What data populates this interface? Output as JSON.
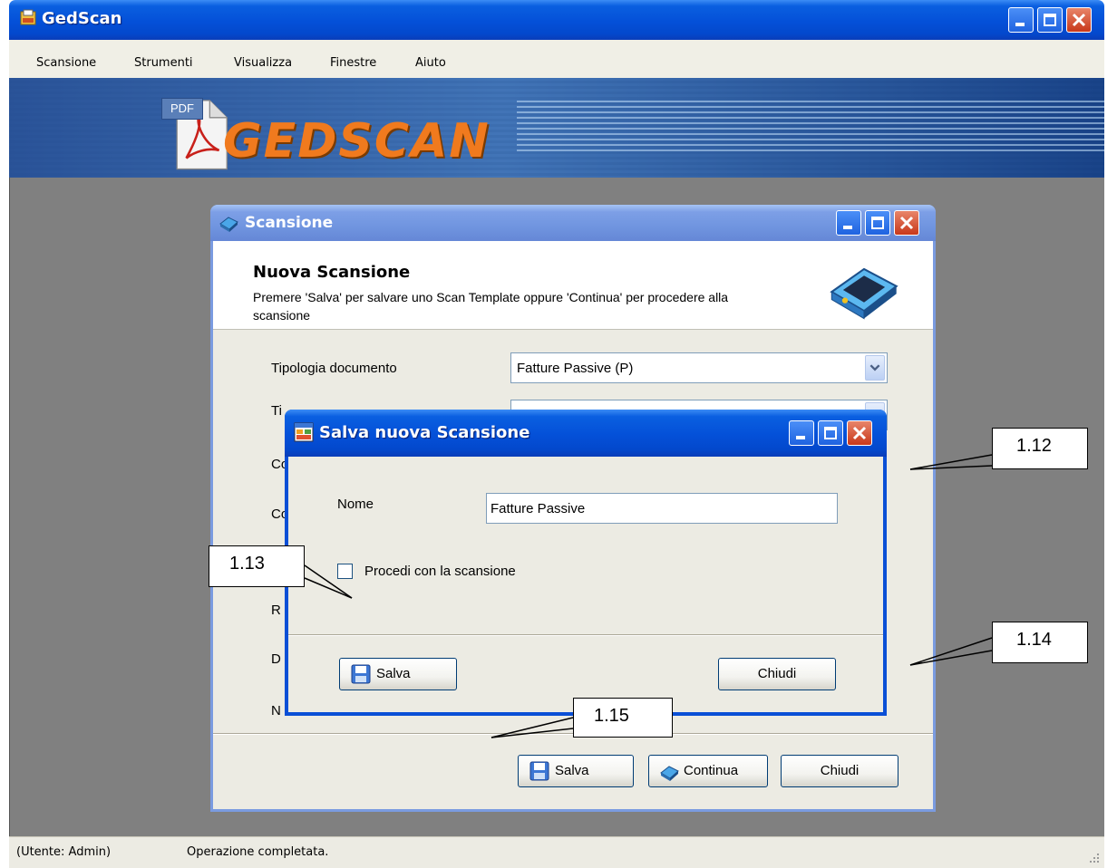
{
  "window": {
    "title": "GedScan"
  },
  "menu": {
    "items": [
      "Scansione",
      "Strumenti",
      "Visualizza",
      "Finestre",
      "Aiuto"
    ]
  },
  "banner": {
    "pdf_badge": "PDF",
    "logo": "GEDSCAN"
  },
  "status": {
    "user": "(Utente: Admin)",
    "message": "Operazione completata."
  },
  "scan_dialog": {
    "title": "Scansione",
    "heading": "Nuova Scansione",
    "description": "Premere 'Salva' per salvare uno Scan Template oppure 'Continua' per procedere alla scansione",
    "fields": {
      "tipologia_label": "Tipologia documento",
      "tipologia_value": "Fatture Passive (P)",
      "label_2": "Ti",
      "label_3": "Co",
      "label_4": "Co",
      "label_5": "R",
      "label_6": "D",
      "label_7": "N"
    },
    "buttons": {
      "save": "Salva",
      "continue": "Continua",
      "close": "Chiudi"
    }
  },
  "save_dialog": {
    "title": "Salva nuova Scansione",
    "name_label": "Nome",
    "name_value": "Fatture Passive",
    "checkbox_label": "Procedi con la scansione",
    "checkbox_checked": false,
    "buttons": {
      "save": "Salva",
      "close": "Chiudi"
    }
  },
  "callouts": [
    "1.12",
    "1.13",
    "1.14",
    "1.15"
  ]
}
